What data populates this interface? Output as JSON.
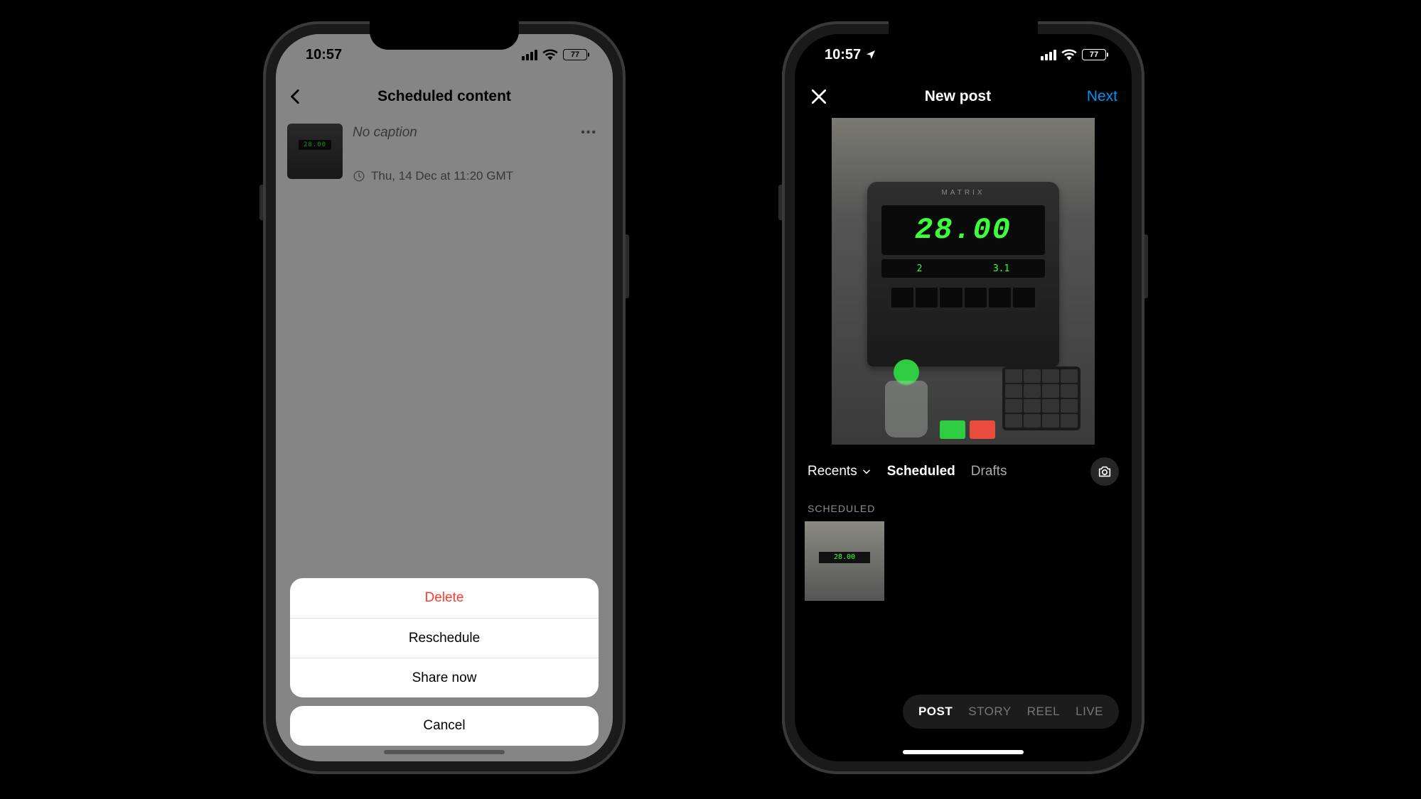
{
  "status": {
    "time": "10:57",
    "battery": "77"
  },
  "left": {
    "title": "Scheduled content",
    "item": {
      "caption": "No caption",
      "schedule": "Thu, 14 Dec at 11:20 GMT"
    },
    "sheet": {
      "delete": "Delete",
      "reschedule": "Reschedule",
      "share_now": "Share now",
      "cancel": "Cancel"
    }
  },
  "right": {
    "title": "New post",
    "next": "Next",
    "preview": {
      "brand": "MATRIX",
      "readout": "28.00",
      "sub_left": "2",
      "sub_right": "3.1"
    },
    "tabs": {
      "recents": "Recents",
      "scheduled": "Scheduled",
      "drafts": "Drafts"
    },
    "section_label": "SCHEDULED",
    "modes": {
      "post": "POST",
      "story": "STORY",
      "reel": "REEL",
      "live": "LIVE"
    }
  },
  "colors": {
    "danger": "#ff3b30",
    "link": "#0095f6",
    "led": "#3cff3c"
  }
}
